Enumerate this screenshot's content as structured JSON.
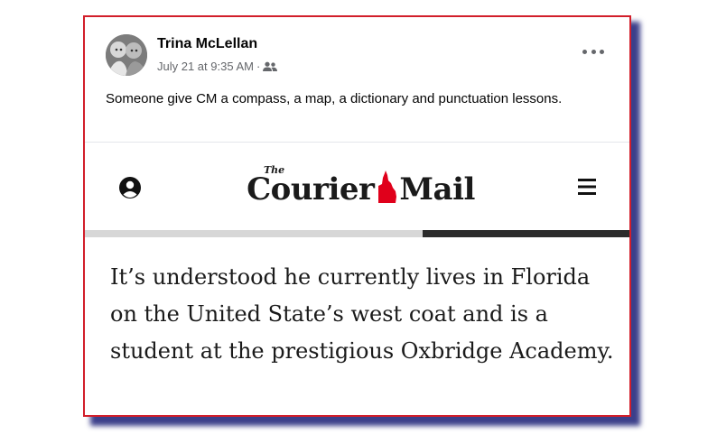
{
  "post": {
    "author": "Trina McLellan",
    "timestamp": "July 21 at 9:35 AM",
    "separator": "·",
    "audience_icon": "friends-icon",
    "more_icon": "more-options-icon",
    "text": "Someone give CM a compass, a map, a dictionary and punctuation lessons."
  },
  "news": {
    "masthead_the": "The",
    "masthead_word1": "Courier",
    "masthead_word2": "Mail",
    "account_icon": "account-icon",
    "menu_icon": "hamburger-menu-icon",
    "reading_progress": 0.38,
    "article_text": "It’s understood he currently lives in Florida on the United State’s west coat and is a student at the prestigious Oxbridge Academy."
  },
  "colors": {
    "frame_border": "#d21e2a",
    "shadow": "#3b3f8a",
    "qld_red": "#e0001b",
    "progress_fill": "#2b2b2b",
    "progress_track": "#d7d7d7"
  }
}
